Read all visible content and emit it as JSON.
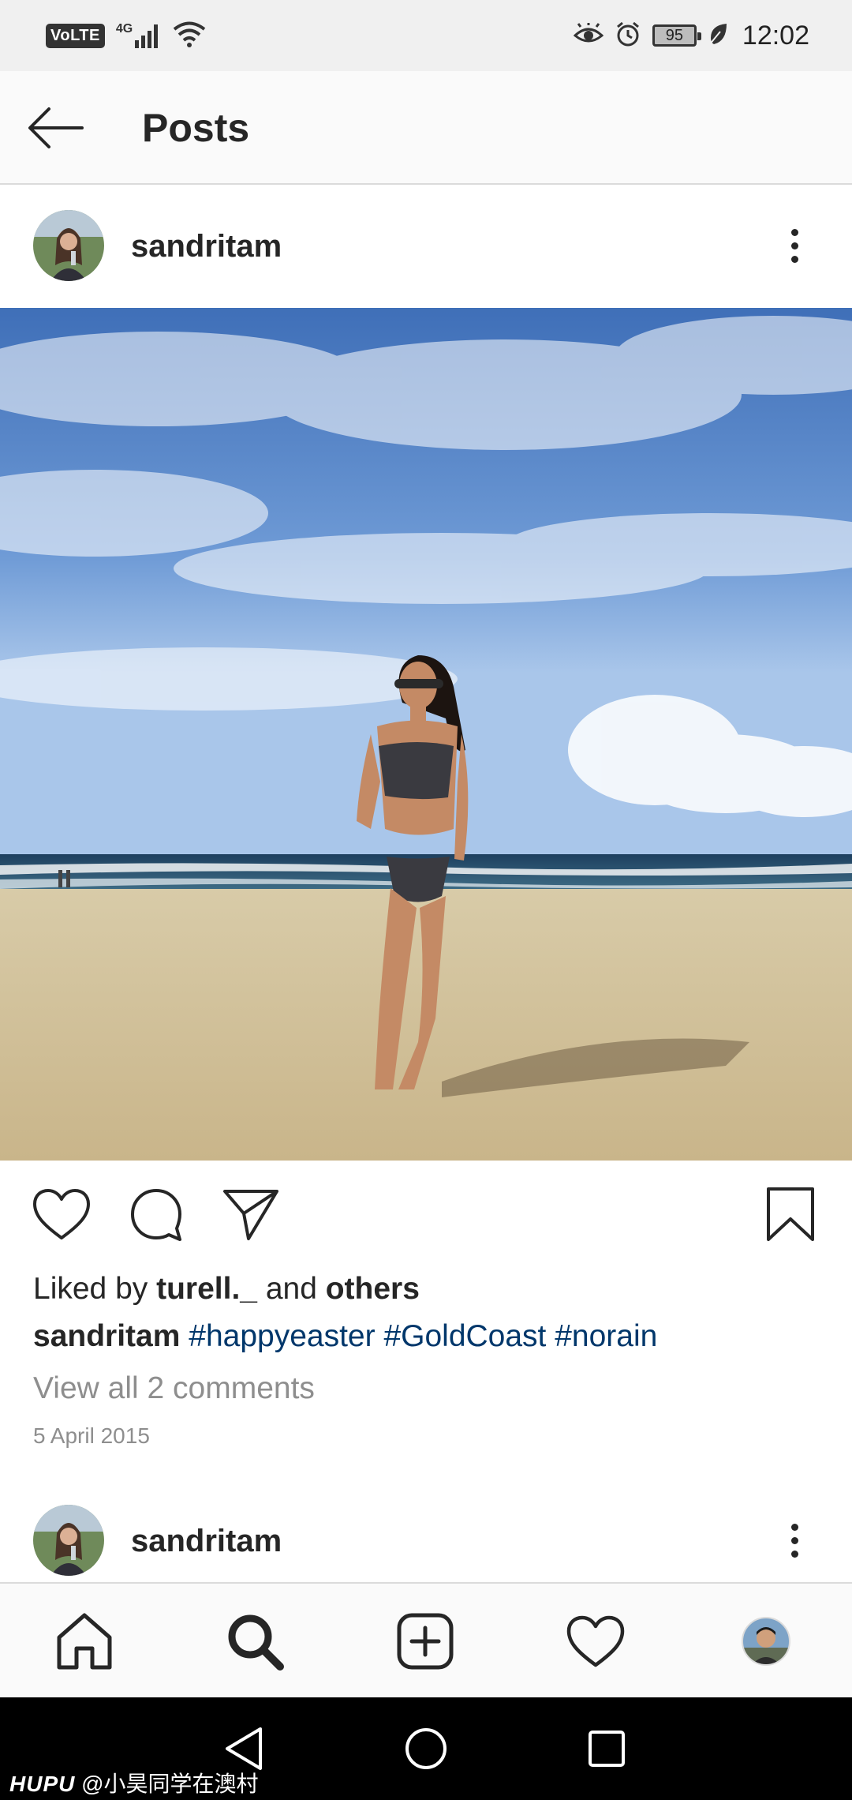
{
  "status_bar": {
    "volte": "VoLTE",
    "network": "4G",
    "battery": "95",
    "time": "12:02",
    "icons_left": [
      "volte-badge",
      "signal-icon",
      "wifi-icon"
    ],
    "icons_right": [
      "eye-icon",
      "alarm-icon",
      "battery-icon",
      "leaf-icon"
    ]
  },
  "header": {
    "title": "Posts",
    "back_icon": "arrow-left-icon"
  },
  "posts": [
    {
      "username": "sandritam",
      "likes": {
        "prefix": "Liked by ",
        "liker": "turell._",
        "middle": " and ",
        "others": "others"
      },
      "caption": {
        "author": "sandritam",
        "hashtags": [
          "#happyeaster",
          "#GoldCoast",
          "#norain"
        ]
      },
      "comments_link": "View all 2 comments",
      "date": "5 April 2015"
    },
    {
      "username": "sandritam"
    }
  ],
  "actions": [
    "heart-icon",
    "comment-icon",
    "share-icon",
    "bookmark-icon"
  ],
  "bottom_nav": [
    "home-icon",
    "search-icon",
    "add-post-icon",
    "activity-heart-icon",
    "profile-avatar"
  ],
  "watermark": {
    "brand": "HUPU",
    "handle": "@小昊同学在澳村"
  },
  "colors": {
    "text": "#262626",
    "muted": "#8e8e8e",
    "hashtag": "#00376b",
    "divider": "#dbdbdb",
    "status_bg": "#f0f0f0"
  }
}
